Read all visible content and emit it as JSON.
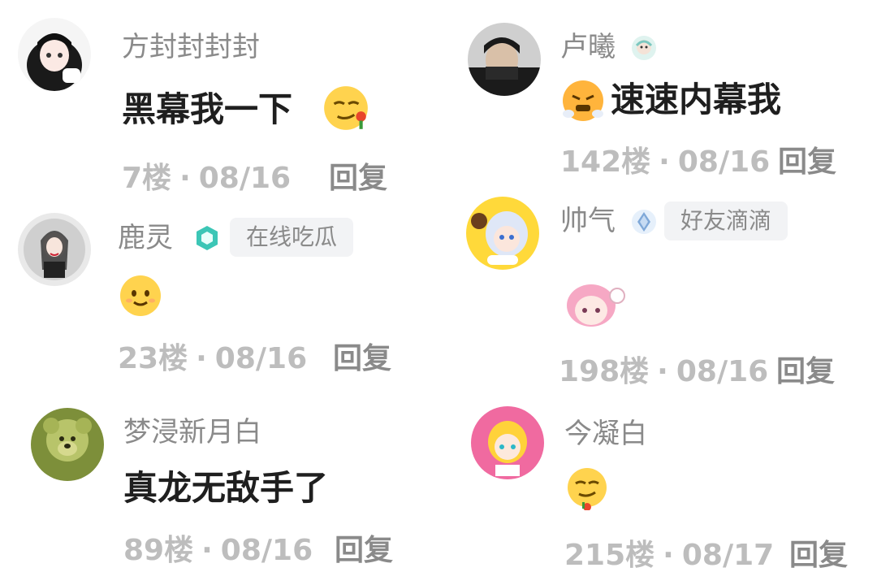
{
  "comments": [
    {
      "username": "方封封封封",
      "text": "黑幕我一下",
      "floor": "7楼",
      "date": "08/16",
      "reply": "回复",
      "emoji": "smirk-flower-emoji"
    },
    {
      "username": "卢曦",
      "text": "速速内幕我",
      "floor": "142楼",
      "date": "08/16",
      "reply": "回复",
      "badge": "anime-badge-icon",
      "emoji": "angry-steam-emoji"
    },
    {
      "username": "鹿灵",
      "tag": "在线吃瓜",
      "floor": "23楼",
      "date": "08/16",
      "reply": "回复",
      "badge": "teal-hexagon-badge-icon",
      "emoji": "smile-emoji"
    },
    {
      "username": "帅气",
      "tag": "好友滴滴",
      "floor": "198楼",
      "date": "08/16",
      "reply": "回复",
      "badge": "blue-crystal-badge-icon",
      "emoji": "pink-hair-girl-sticker"
    },
    {
      "username": "梦浸新月白",
      "text": "真龙无敌手了",
      "floor": "89楼",
      "date": "08/16",
      "reply": "回复"
    },
    {
      "username": "今凝白",
      "floor": "215楼",
      "date": "08/17",
      "reply": "回复",
      "emoji": "smirk-flower-emoji"
    }
  ],
  "separator": "·"
}
